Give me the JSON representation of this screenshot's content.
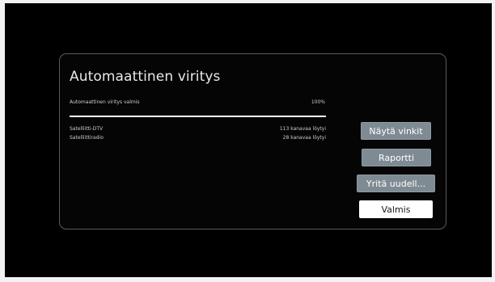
{
  "dialog": {
    "title": "Automaattinen viritys",
    "status_label": "Automaattinen viritys valmis",
    "status_percent": "100%",
    "progress_fraction": 1.0,
    "results": [
      {
        "name": "Satelliitti-DTV",
        "count": "113 kanavaa löytyi"
      },
      {
        "name": "Satelliittiradio",
        "count": "28 kanavaa löytyi"
      }
    ],
    "buttons": {
      "tips": "Näytä vinkit",
      "report": "Raportti",
      "retry": "Yritä uudell...",
      "done": "Valmis"
    }
  },
  "colors": {
    "screen_bg": "#000000",
    "button_bg": "#7f8b93",
    "primary_button_bg": "#ffffff"
  }
}
